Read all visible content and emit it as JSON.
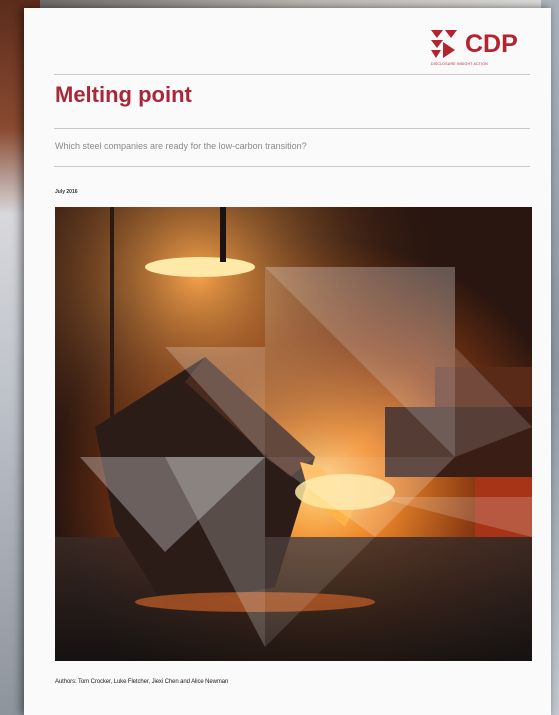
{
  "logo": {
    "text": "CDP",
    "tagline": "DISCLOSURE INSIGHT ACTION",
    "color": "#b4232f"
  },
  "report": {
    "title": "Melting point",
    "subtitle": "Which steel companies are ready for the low-carbon transition?",
    "date": "July 2016",
    "authors": "Authors: Tom Crocker, Luke Fletcher, Jiexi Chen and Alice Newman"
  },
  "colors": {
    "title": "#a8283a",
    "rule": "#c9c9c9"
  },
  "cover_image": {
    "description_icon": "steel-ladle-photo-icon",
    "overlay": "white-triangle-pattern"
  }
}
